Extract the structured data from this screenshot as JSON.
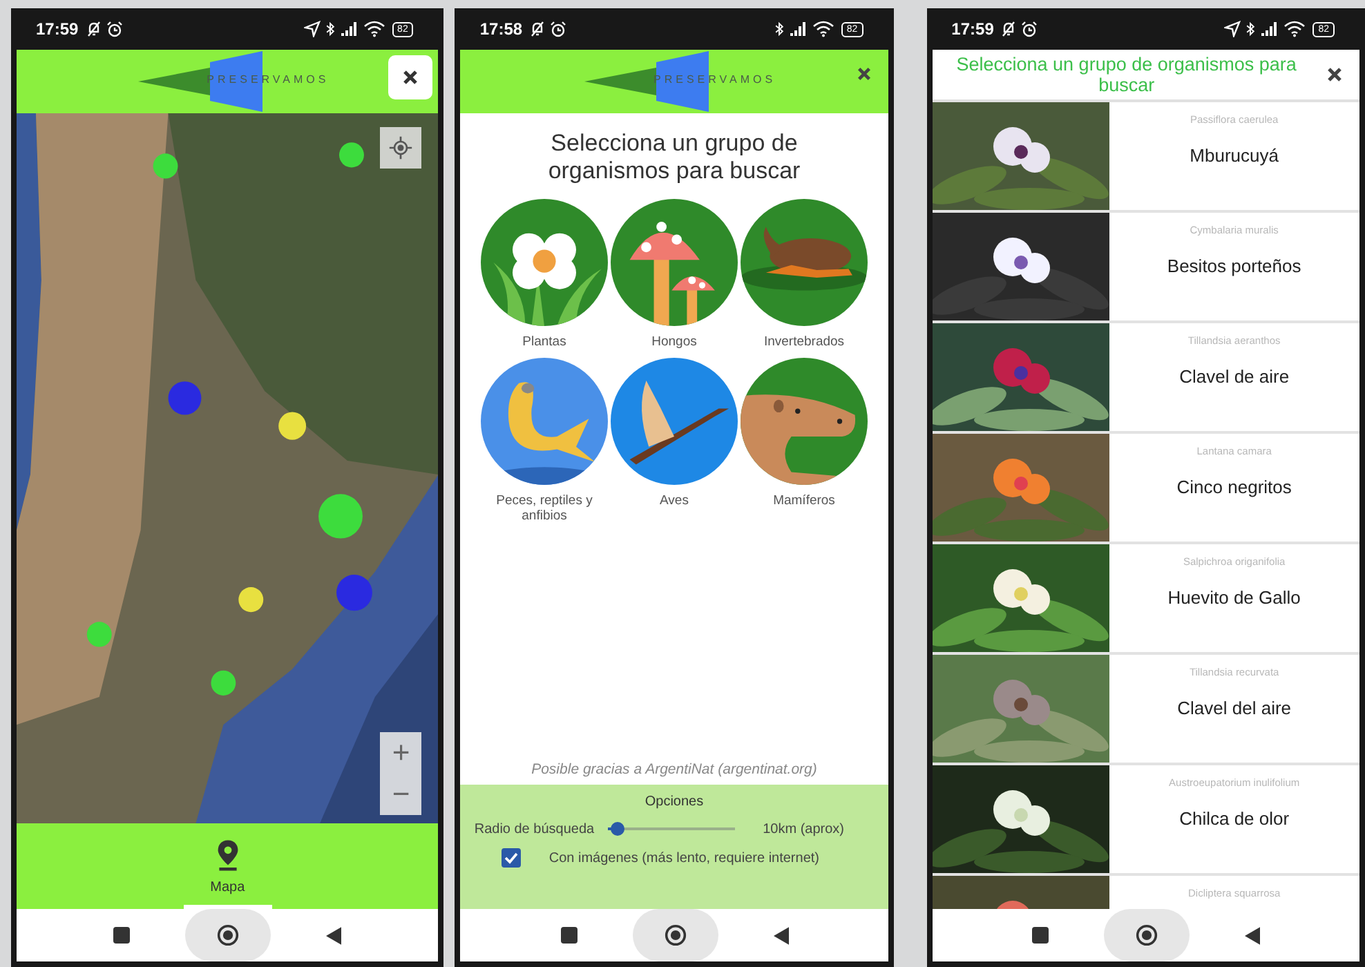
{
  "screens": [
    {
      "kind": "map",
      "status_bar": {
        "time": "17:59",
        "location": true,
        "battery": "82"
      },
      "header": {
        "logo": "PRESERVAMOS"
      },
      "map": {
        "zoom_in": "+",
        "zoom_out": "−"
      },
      "bottom_tabs": [
        {
          "label": "Mapa",
          "selected": true
        }
      ]
    },
    {
      "kind": "groups",
      "status_bar": {
        "time": "17:58",
        "location": false,
        "battery": "82"
      },
      "header": {
        "logo": "PRESERVAMOS"
      },
      "title": "Selecciona un grupo de organismos para buscar",
      "groups": [
        {
          "kind": "plants",
          "label": "Plantas"
        },
        {
          "kind": "fungi",
          "label": "Hongos"
        },
        {
          "kind": "invertebrates",
          "label": "Invertebrados"
        },
        {
          "kind": "fish",
          "label": "Peces, reptiles y anfibios"
        },
        {
          "kind": "birds",
          "label": "Aves"
        },
        {
          "kind": "mammals",
          "label": "Mamíferos"
        }
      ],
      "credit": "Posible gracias a ArgentiNat (argentinat.org)",
      "options": {
        "title": "Opciones",
        "radius_label": "Radio de búsqueda",
        "radius": {
          "level": 0.08
        },
        "radius_value": "10km (aprox)",
        "images": {
          "label": "Con imágenes (más lento, requiere internet)",
          "checked": true
        }
      }
    },
    {
      "kind": "species",
      "status_bar": {
        "time": "17:59",
        "location": true,
        "battery": "82"
      },
      "title": "Selecciona un grupo de organismos para buscar",
      "species": [
        {
          "scientific": "Passiflora caerulea",
          "common": "Mburucuyá"
        },
        {
          "scientific": "Cymbalaria muralis",
          "common": "Besitos porteños"
        },
        {
          "scientific": "Tillandsia aeranthos",
          "common": "Clavel de aire"
        },
        {
          "scientific": "Lantana camara",
          "common": "Cinco negritos"
        },
        {
          "scientific": "Salpichroa origanifolia",
          "common": "Huevito de Gallo"
        },
        {
          "scientific": "Tillandsia recurvata",
          "common": "Clavel del aire"
        },
        {
          "scientific": "Austroeupatorium inulifolium",
          "common": "Chilca de olor"
        },
        {
          "scientific": "Dicliptera squarrosa"
        }
      ]
    }
  ]
}
